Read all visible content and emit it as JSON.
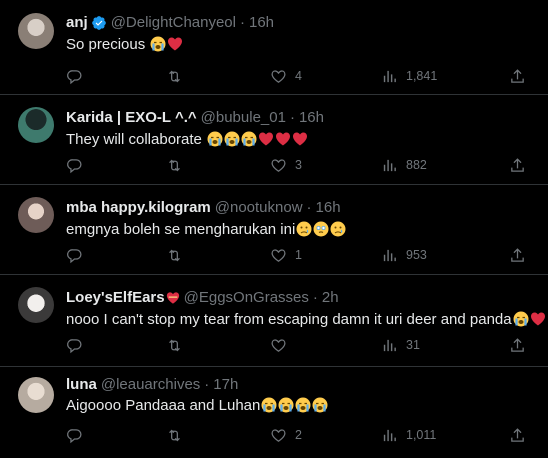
{
  "tweets": [
    {
      "name": "anj",
      "verified": true,
      "handle": "@DelightChanyeol",
      "time": "16h",
      "text": "So precious",
      "emojis": [
        "loudly-crying",
        "red-heart"
      ],
      "likes": "4",
      "views": "1,841",
      "avatar_color": "#8a7f76"
    },
    {
      "name": "Karida | EXO-L ^.^",
      "handle": "@bubule_01",
      "time": "16h",
      "text": "They will collaborate",
      "emojis": [
        "loudly-crying",
        "loudly-crying",
        "loudly-crying",
        "red-heart",
        "red-heart",
        "red-heart"
      ],
      "likes": "3",
      "views": "882",
      "avatar_color": "#2f5a54"
    },
    {
      "name": "mba happy.kilogram",
      "handle": "@nootuknow",
      "time": "16h",
      "text": "emgnya boleh se mengharukan ini",
      "emojis": [
        "crying-face",
        "holding-back-tears",
        "crying-face"
      ],
      "likes": "1",
      "views": "953",
      "avatar_color": "#6e5c58"
    },
    {
      "name": "Loey'sElfEars",
      "name_emoji": "heart-with-ribbon",
      "handle": "@EggsOnGrasses",
      "time": "2h",
      "text": "nooo I can't stop my tear from escaping damn it uri deer and panda",
      "emojis": [
        "loudly-crying",
        "red-heart"
      ],
      "likes": "",
      "views": "31",
      "avatar_color": "#c9c6c4"
    },
    {
      "name": "luna",
      "handle": "@leauarchives",
      "time": "17h",
      "text": "Aigoooo Pandaaa and Luhan",
      "emojis": [
        "loudly-crying",
        "loudly-crying",
        "loudly-crying",
        "loudly-crying"
      ],
      "likes": "2",
      "views": "1,011",
      "avatar_color": "#b6aba0"
    }
  ],
  "colors": {
    "background": "#000000",
    "text": "#e7e9ea",
    "secondary": "#71767b",
    "divider": "#2f3336",
    "verified": "#1d9bf0",
    "heart": "#f91880"
  }
}
